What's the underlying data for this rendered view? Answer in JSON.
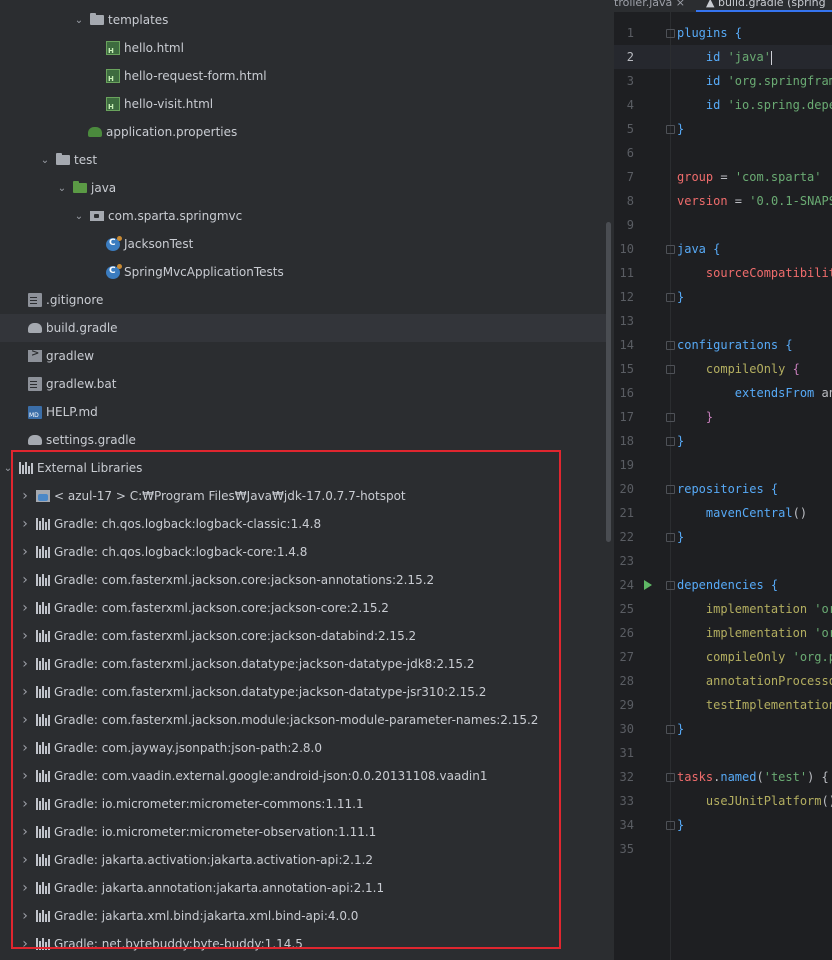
{
  "tree": {
    "items": [
      {
        "label": "templates",
        "icon": "folder-icon",
        "kind": "folder",
        "expanded": true
      },
      {
        "label": "hello.html",
        "icon": "html-file-icon",
        "kind": "html"
      },
      {
        "label": "hello-request-form.html",
        "icon": "html-file-icon",
        "kind": "html"
      },
      {
        "label": "hello-visit.html",
        "icon": "html-file-icon",
        "kind": "html"
      },
      {
        "label": "application.properties",
        "icon": "spring-properties-icon",
        "kind": "props"
      },
      {
        "label": "test",
        "icon": "folder-icon",
        "kind": "folder",
        "expanded": true
      },
      {
        "label": "java",
        "icon": "test-source-folder-icon",
        "kind": "greenfolder",
        "expanded": true
      },
      {
        "label": "com.sparta.springmvc",
        "icon": "package-icon",
        "kind": "pkg",
        "expanded": true
      },
      {
        "label": "JacksonTest",
        "icon": "test-class-icon",
        "kind": "class"
      },
      {
        "label": "SpringMvcApplicationTests",
        "icon": "test-class-icon",
        "kind": "class"
      },
      {
        "label": ".gitignore",
        "icon": "gitignore-file-icon",
        "kind": "file"
      },
      {
        "label": "build.gradle",
        "icon": "gradle-icon",
        "kind": "gradle",
        "selected": true
      },
      {
        "label": "gradlew",
        "icon": "shell-script-icon",
        "kind": "term"
      },
      {
        "label": "gradlew.bat",
        "icon": "text-file-icon",
        "kind": "file"
      },
      {
        "label": "HELP.md",
        "icon": "markdown-icon",
        "kind": "md"
      },
      {
        "label": "settings.gradle",
        "icon": "gradle-icon",
        "kind": "gradle"
      },
      {
        "label": "External Libraries",
        "icon": "library-icon",
        "kind": "lib",
        "expanded": true
      },
      {
        "label": "< azul-17 >  C:₩Program Files₩Java₩jdk-17.0.7.7-hotspot",
        "icon": "jdk-icon",
        "kind": "jdk",
        "expanded": false
      },
      {
        "label": "Gradle: ch.qos.logback:logback-classic:1.4.8",
        "icon": "library-icon",
        "kind": "lib",
        "expanded": false
      },
      {
        "label": "Gradle: ch.qos.logback:logback-core:1.4.8",
        "icon": "library-icon",
        "kind": "lib",
        "expanded": false
      },
      {
        "label": "Gradle: com.fasterxml.jackson.core:jackson-annotations:2.15.2",
        "icon": "library-icon",
        "kind": "lib",
        "expanded": false
      },
      {
        "label": "Gradle: com.fasterxml.jackson.core:jackson-core:2.15.2",
        "icon": "library-icon",
        "kind": "lib",
        "expanded": false
      },
      {
        "label": "Gradle: com.fasterxml.jackson.core:jackson-databind:2.15.2",
        "icon": "library-icon",
        "kind": "lib",
        "expanded": false
      },
      {
        "label": "Gradle: com.fasterxml.jackson.datatype:jackson-datatype-jdk8:2.15.2",
        "icon": "library-icon",
        "kind": "lib",
        "expanded": false
      },
      {
        "label": "Gradle: com.fasterxml.jackson.datatype:jackson-datatype-jsr310:2.15.2",
        "icon": "library-icon",
        "kind": "lib",
        "expanded": false
      },
      {
        "label": "Gradle: com.fasterxml.jackson.module:jackson-module-parameter-names:2.15.2",
        "icon": "library-icon",
        "kind": "lib",
        "expanded": false
      },
      {
        "label": "Gradle: com.jayway.jsonpath:json-path:2.8.0",
        "icon": "library-icon",
        "kind": "lib",
        "expanded": false
      },
      {
        "label": "Gradle: com.vaadin.external.google:android-json:0.0.20131108.vaadin1",
        "icon": "library-icon",
        "kind": "lib",
        "expanded": false
      },
      {
        "label": "Gradle: io.micrometer:micrometer-commons:1.11.1",
        "icon": "library-icon",
        "kind": "lib",
        "expanded": false
      },
      {
        "label": "Gradle: io.micrometer:micrometer-observation:1.11.1",
        "icon": "library-icon",
        "kind": "lib",
        "expanded": false
      },
      {
        "label": "Gradle: jakarta.activation:jakarta.activation-api:2.1.2",
        "icon": "library-icon",
        "kind": "lib",
        "expanded": false
      },
      {
        "label": "Gradle: jakarta.annotation:jakarta.annotation-api:2.1.1",
        "icon": "library-icon",
        "kind": "lib",
        "expanded": false
      },
      {
        "label": "Gradle: jakarta.xml.bind:jakarta.xml.bind-api:4.0.0",
        "icon": "library-icon",
        "kind": "lib",
        "expanded": false
      },
      {
        "label": "Gradle: net.bytebuddy:byte-buddy:1.14.5",
        "icon": "library-icon",
        "kind": "lib",
        "expanded": false
      }
    ]
  },
  "editor": {
    "tabs": [
      {
        "label": "troller.java",
        "close": "×",
        "active": false
      },
      {
        "label": "build.gradle (spring",
        "active": true
      }
    ],
    "current_line": 2,
    "lines": [
      {
        "n": "1",
        "parts": [
          [
            "plugins {",
            "fn"
          ]
        ]
      },
      {
        "n": "2",
        "parts": [
          [
            "    id ",
            "fn"
          ],
          [
            "'java'",
            "str"
          ]
        ],
        "cursor": true
      },
      {
        "n": "3",
        "parts": [
          [
            "    id ",
            "fn"
          ],
          [
            "'org.springfram",
            "str"
          ]
        ]
      },
      {
        "n": "4",
        "parts": [
          [
            "    id ",
            "fn"
          ],
          [
            "'io.spring.depe",
            "str"
          ]
        ]
      },
      {
        "n": "5",
        "parts": [
          [
            "}",
            "fn"
          ]
        ]
      },
      {
        "n": "6",
        "parts": []
      },
      {
        "n": "7",
        "parts": [
          [
            "group",
            "red"
          ],
          [
            " = ",
            "plain"
          ],
          [
            "'com.sparta'",
            "str"
          ]
        ]
      },
      {
        "n": "8",
        "parts": [
          [
            "version",
            "red"
          ],
          [
            " = ",
            "plain"
          ],
          [
            "'0.0.1-SNAPS",
            "str"
          ]
        ]
      },
      {
        "n": "9",
        "parts": []
      },
      {
        "n": "10",
        "parts": [
          [
            "java {",
            "fn"
          ]
        ]
      },
      {
        "n": "11",
        "parts": [
          [
            "    ",
            "plain"
          ],
          [
            "sourceCompatibilit",
            "red"
          ]
        ]
      },
      {
        "n": "12",
        "parts": [
          [
            "}",
            "fn"
          ]
        ]
      },
      {
        "n": "13",
        "parts": []
      },
      {
        "n": "14",
        "parts": [
          [
            "configurations {",
            "fn"
          ]
        ]
      },
      {
        "n": "15",
        "parts": [
          [
            "    compileOnly ",
            "gr"
          ],
          [
            "{",
            "prop"
          ]
        ]
      },
      {
        "n": "16",
        "parts": [
          [
            "        extendsFrom ",
            "fn"
          ],
          [
            "an",
            "plain"
          ]
        ]
      },
      {
        "n": "17",
        "parts": [
          [
            "    ",
            "plain"
          ],
          [
            "}",
            "prop"
          ]
        ]
      },
      {
        "n": "18",
        "parts": [
          [
            "}",
            "fn"
          ]
        ]
      },
      {
        "n": "19",
        "parts": []
      },
      {
        "n": "20",
        "parts": [
          [
            "repositories {",
            "fn"
          ]
        ]
      },
      {
        "n": "21",
        "parts": [
          [
            "    mavenCentral",
            "fn"
          ],
          [
            "()",
            "plain"
          ]
        ]
      },
      {
        "n": "22",
        "parts": [
          [
            "}",
            "fn"
          ]
        ]
      },
      {
        "n": "23",
        "parts": []
      },
      {
        "n": "24",
        "parts": [
          [
            "dependencies {",
            "fn"
          ]
        ],
        "run": true
      },
      {
        "n": "25",
        "parts": [
          [
            "    implementation ",
            "gr"
          ],
          [
            "'or",
            "str"
          ]
        ]
      },
      {
        "n": "26",
        "parts": [
          [
            "    implementation ",
            "gr"
          ],
          [
            "'or",
            "str"
          ]
        ]
      },
      {
        "n": "27",
        "parts": [
          [
            "    compileOnly ",
            "gr"
          ],
          [
            "'org.p",
            "str"
          ]
        ]
      },
      {
        "n": "28",
        "parts": [
          [
            "    annotationProcesso",
            "gr"
          ]
        ]
      },
      {
        "n": "29",
        "parts": [
          [
            "    testImplementation",
            "gr"
          ]
        ]
      },
      {
        "n": "30",
        "parts": [
          [
            "}",
            "fn"
          ]
        ]
      },
      {
        "n": "31",
        "parts": []
      },
      {
        "n": "32",
        "parts": [
          [
            "tasks",
            "red"
          ],
          [
            ".",
            "plain"
          ],
          [
            "named",
            "fn"
          ],
          [
            "(",
            "plain"
          ],
          [
            "'test'",
            "str"
          ],
          [
            ") { ",
            "plain"
          ]
        ]
      },
      {
        "n": "33",
        "parts": [
          [
            "    useJUnitPlatform",
            "gr"
          ],
          [
            "()",
            "plain"
          ]
        ]
      },
      {
        "n": "34",
        "parts": [
          [
            "}",
            "fn"
          ]
        ]
      },
      {
        "n": "35",
        "parts": []
      }
    ]
  }
}
